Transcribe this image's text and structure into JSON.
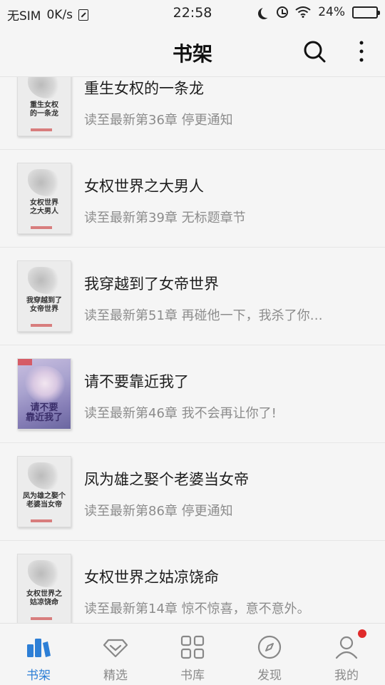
{
  "status_bar": {
    "carrier": "无SIM",
    "net_speed": "0K/s",
    "time": "22:58",
    "battery": "24%",
    "battery_level": 0.24,
    "icons": [
      "sim-off-icon",
      "moon-icon",
      "alarm-icon",
      "wifi-icon",
      "battery-icon"
    ]
  },
  "header": {
    "title": "书架",
    "icons": [
      "search-icon",
      "more-icon"
    ]
  },
  "books": [
    {
      "title": "重生女权的一条龙",
      "progress": "读至最新第36章 停更通知",
      "cover_text": "重生女权\n的一条龙"
    },
    {
      "title": "女权世界之大男人",
      "progress": "读至最新第39章 无标题章节",
      "cover_text": "女权世界\n之大男人"
    },
    {
      "title": "我穿越到了女帝世界",
      "progress": "读至最新第51章 再碰他一下，我杀了你…",
      "cover_text": "我穿越到了\n女帝世界"
    },
    {
      "title": "请不要靠近我了",
      "progress": "读至最新第46章 我不会再让你了!",
      "cover_text": "请不要\n靠近我了"
    },
    {
      "title": "凤为雄之娶个老婆当女帝",
      "progress": "读至最新第86章 停更通知",
      "cover_text": "凤为雄之娶个\n老婆当女帝"
    },
    {
      "title": "女权世界之姑凉饶命",
      "progress": "读至最新第14章 惊不惊喜，意不意外。",
      "cover_text": "女权世界之\n姑凉饶命"
    }
  ],
  "bottom_nav": [
    {
      "label": "书架",
      "icon": "bookshelf-icon",
      "active": true
    },
    {
      "label": "精选",
      "icon": "diamond-icon",
      "active": false
    },
    {
      "label": "书库",
      "icon": "grid-icon",
      "active": false
    },
    {
      "label": "发现",
      "icon": "compass-icon",
      "active": false
    },
    {
      "label": "我的",
      "icon": "user-icon",
      "active": false,
      "badge": true
    }
  ],
  "colors": {
    "background": "#f5f5f5",
    "accent": "#2d7fd6",
    "badge": "#e02b2b",
    "secondary_text": "#8c8c8c"
  }
}
